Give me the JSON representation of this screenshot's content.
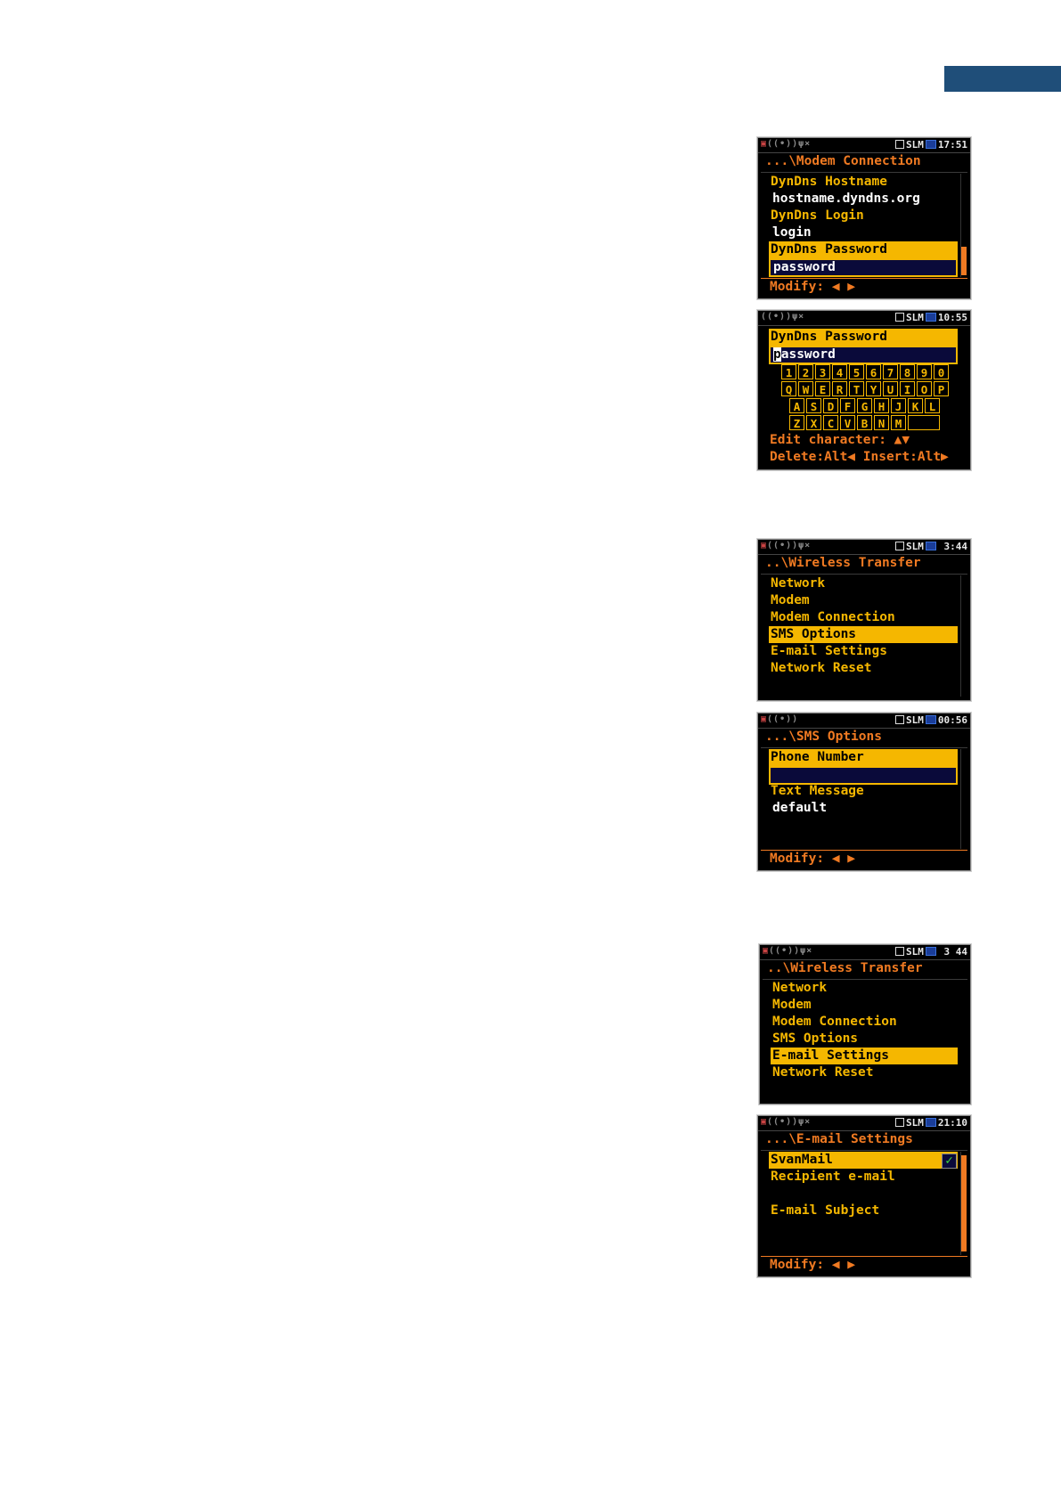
{
  "s1": {
    "time": "17:51",
    "mode": "SLM",
    "title": "...\\Modem Connection",
    "items": [
      "DynDns Hostname",
      "hostname.dyndns.org",
      "DynDns Login",
      "login",
      "DynDns Password",
      "password"
    ],
    "footer": "Modify: ◀ ▶"
  },
  "s2": {
    "time": "10:55",
    "mode": "SLM",
    "field_label": "DynDns Password",
    "field_cursor": "p",
    "field_rest": "assword",
    "keys_row1": [
      "1",
      "2",
      "3",
      "4",
      "5",
      "6",
      "7",
      "8",
      "9",
      "0"
    ],
    "keys_row2": [
      "Q",
      "W",
      "E",
      "R",
      "T",
      "Y",
      "U",
      "I",
      "O",
      "P"
    ],
    "keys_row3": [
      "A",
      "S",
      "D",
      "F",
      "G",
      "H",
      "J",
      "K",
      "L"
    ],
    "keys_row4": [
      "Z",
      "X",
      "C",
      "V",
      "B",
      "N",
      "M"
    ],
    "hint1": "Edit character: ▲▼",
    "hint2": "Delete:Alt◀ Insert:Alt▶"
  },
  "s3": {
    "time": "3:44",
    "mode": "SLM",
    "title": "..\\Wireless Transfer",
    "items": [
      "Network",
      "Modem",
      "Modem Connection",
      "SMS Options",
      "E-mail Settings",
      "Network Reset"
    ]
  },
  "s4": {
    "time": "00:56",
    "mode": "SLM",
    "title": "...\\SMS Options",
    "items": [
      "Phone Number",
      "",
      "Text Message",
      "default"
    ],
    "footer": "Modify: ◀ ▶"
  },
  "s5": {
    "time": "3 44",
    "mode": "SLM",
    "title": "..\\Wireless Transfer",
    "items": [
      "Network",
      "Modem",
      "Modem Connection",
      "SMS Options",
      "E-mail Settings",
      "Network Reset"
    ]
  },
  "s6": {
    "time": "21:10",
    "mode": "SLM",
    "title": "...\\E-mail Settings",
    "items": [
      "SvanMail",
      "Recipient e-mail",
      "E-mail Subject"
    ],
    "footer": "Modify: ◀ ▶"
  }
}
